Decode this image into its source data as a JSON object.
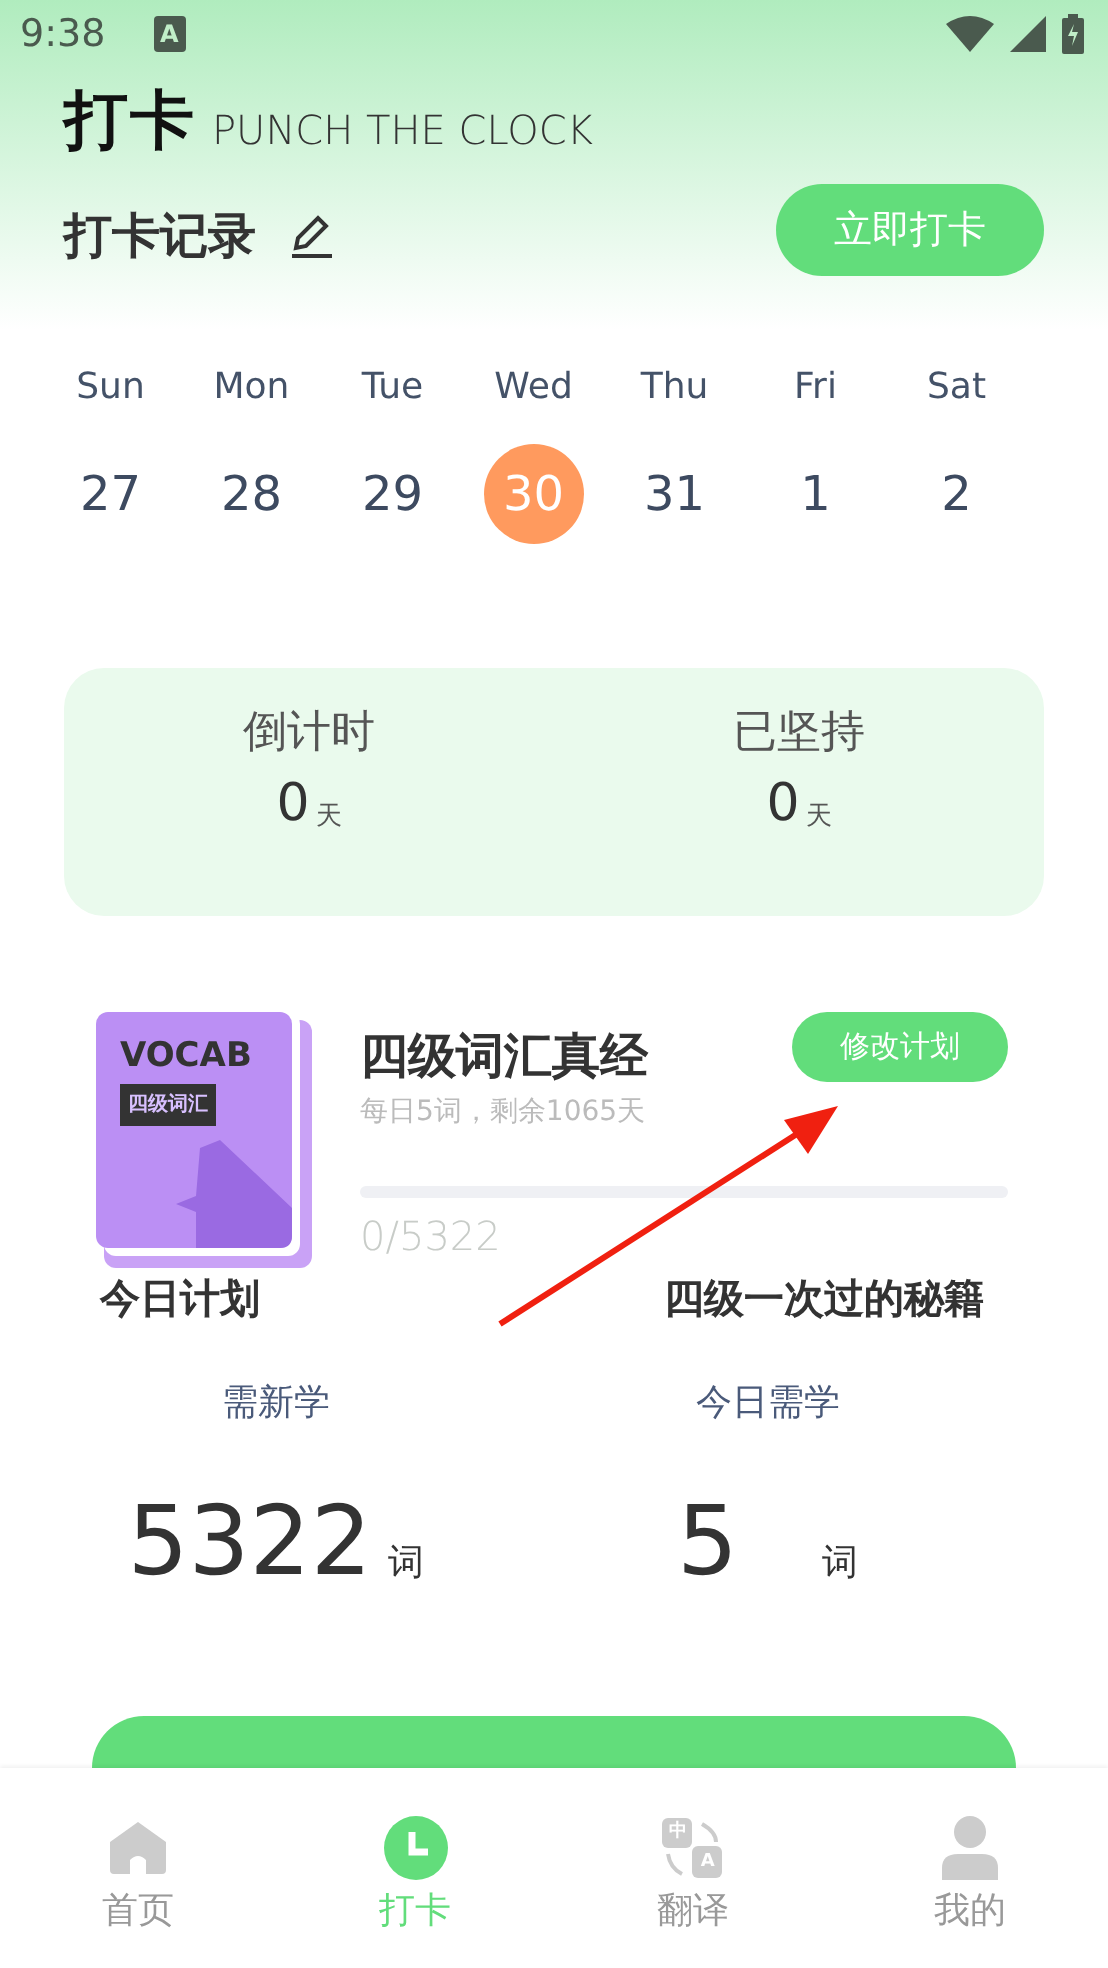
{
  "status_bar": {
    "time": "9:38",
    "notification": "A"
  },
  "header": {
    "title": "打卡",
    "subtitle": "PUNCH THE CLOCK"
  },
  "record": {
    "title": "打卡记录",
    "button": "立即打卡"
  },
  "week": [
    {
      "day": "Sun",
      "date": "27",
      "selected": false
    },
    {
      "day": "Mon",
      "date": "28",
      "selected": false
    },
    {
      "day": "Tue",
      "date": "29",
      "selected": false
    },
    {
      "day": "Wed",
      "date": "30",
      "selected": true
    },
    {
      "day": "Thu",
      "date": "31",
      "selected": false
    },
    {
      "day": "Fri",
      "date": "1",
      "selected": false
    },
    {
      "day": "Sat",
      "date": "2",
      "selected": false
    }
  ],
  "stats": [
    {
      "label": "倒计时",
      "value": "0",
      "unit": "天"
    },
    {
      "label": "已坚持",
      "value": "0",
      "unit": "天"
    }
  ],
  "book": {
    "cover_title": "VOCAB",
    "cover_tag": "四级词汇",
    "title": "四级词汇真经",
    "button": "修改计划",
    "subtitle": "每日5词，剩余1065天",
    "level": 0,
    "progress_text": "0/5322"
  },
  "plan": {
    "title": "今日计划",
    "link": "四级一次过的秘籍",
    "items": [
      {
        "label": "需新学",
        "value": "5322",
        "unit": "词"
      },
      {
        "label": "今日需学",
        "value": "5",
        "unit": "词"
      }
    ]
  },
  "nav": [
    {
      "kind": "home",
      "label": "首页",
      "selected": false
    },
    {
      "kind": "clock",
      "label": "打卡",
      "selected": true
    },
    {
      "kind": "translate",
      "label": "翻译",
      "selected": false,
      "glyphs": [
        "中",
        "A"
      ]
    },
    {
      "kind": "profile",
      "label": "我的",
      "selected": false
    }
  ]
}
